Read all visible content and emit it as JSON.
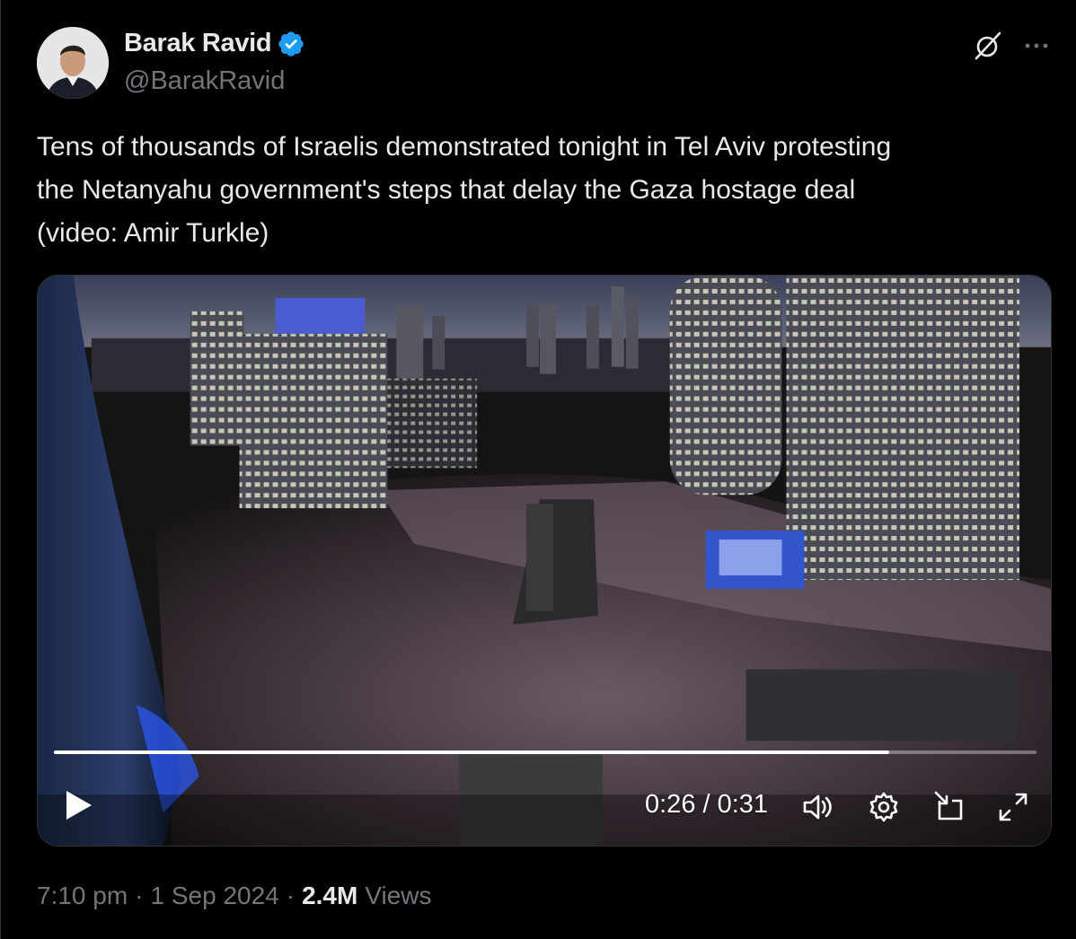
{
  "author": {
    "display_name": "Barak Ravid",
    "handle": "@BarakRavid",
    "verified": true
  },
  "icons": {
    "avatar": "avatar",
    "verified": "verified-badge-icon",
    "grok": "grok-icon",
    "more": "more-icon",
    "play": "play-icon",
    "volume": "volume-icon",
    "settings": "gear-icon",
    "pip": "picture-in-picture-icon",
    "fullscreen": "fullscreen-icon"
  },
  "tweet": {
    "text": "Tens of thousands of Israelis demonstrated tonight in Tel Aviv protesting\nthe Netanyahu government's steps that delay the Gaza hostage deal\n(video: Amir Turkle)"
  },
  "video": {
    "time": "0:26 / 0:31",
    "progress": 0.85
  },
  "meta": {
    "time": "7:10 pm",
    "date": "1 Sep 2024",
    "views_count": "2.4M",
    "views_label": "Views",
    "separator": "·"
  },
  "colors": {
    "background": "#000000",
    "text": "#e7e9ea",
    "muted": "#71767b",
    "verified": "#1d9bf0",
    "border": "#2f3336"
  }
}
